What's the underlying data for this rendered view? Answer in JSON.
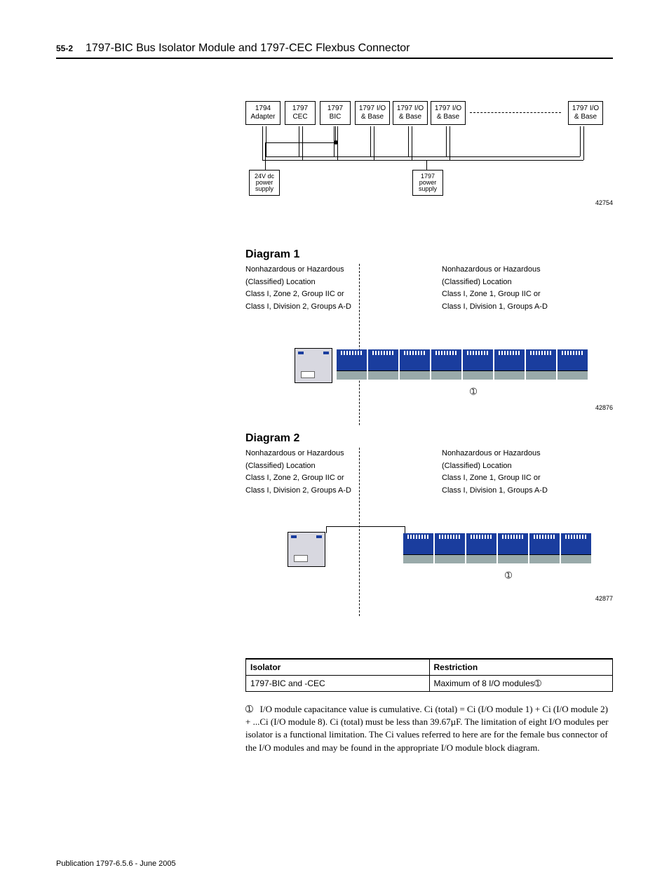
{
  "header": {
    "page_number": "55-2",
    "title": "1797-BIC Bus Isolator Module and 1797-CEC Flexbus Connector"
  },
  "block_diagram": {
    "boxes": [
      {
        "id": "adapter",
        "line1": "1794",
        "line2": "Adapter"
      },
      {
        "id": "cec",
        "line1": "1797",
        "line2": "CEC"
      },
      {
        "id": "bic",
        "line1": "1797",
        "line2": "BIC"
      },
      {
        "id": "io1",
        "line1": "1797 I/O",
        "line2": "& Base"
      },
      {
        "id": "io2",
        "line1": "1797 I/O",
        "line2": "& Base"
      },
      {
        "id": "io3",
        "line1": "1797 I/O",
        "line2": "& Base"
      },
      {
        "id": "ion",
        "line1": "1797 I/O",
        "line2": "& Base"
      }
    ],
    "ps1": {
      "line1": "24V dc",
      "line2": "power",
      "line3": "supply"
    },
    "ps2": {
      "line1": "1797",
      "line2": "power",
      "line3": "supply"
    },
    "fig_id": "42754"
  },
  "diagram1": {
    "title": "Diagram 1",
    "left_loc": {
      "l1": "Nonhazardous or Hazardous",
      "l2": "(Classified) Location",
      "l3": "Class I, Zone 2, Group IIC or",
      "l4": "Class I, Division 2, Groups A-D"
    },
    "right_loc": {
      "l1": "Nonhazardous or Hazardous",
      "l2": "(Classified) Location",
      "l3": "Class I, Zone 1, Group IIC or",
      "l4": "Class I, Division 1, Groups A-D"
    },
    "marker": "➀",
    "fig_id": "42876"
  },
  "diagram2": {
    "title": "Diagram 2",
    "left_loc": {
      "l1": "Nonhazardous or Hazardous",
      "l2": "(Classified) Location",
      "l3": "Class I, Zone 2, Group IIC or",
      "l4": "Class I, Division 2, Groups A-D"
    },
    "right_loc": {
      "l1": "Nonhazardous or Hazardous",
      "l2": "(Classified) Location",
      "l3": "Class I, Zone 1, Group IIC or",
      "l4": "Class I, Division 1, Groups A-D"
    },
    "marker": "➀",
    "fig_id": "42877"
  },
  "table": {
    "headers": {
      "c1": "Isolator",
      "c2": "Restriction"
    },
    "row": {
      "c1": "1797-BIC and -CEC",
      "c2": "Maximum of 8 I/O modules",
      "marker": "➀"
    }
  },
  "footnote": {
    "marker": "➀",
    "text": "I/O module capacitance value is cumulative. Ci (total) = Ci (I/O module 1) + Ci (I/O module 2) + ...Ci (I/O module 8). Ci (total) must be less than 39.67µF. The limitation of eight I/O modules per isolator is a functional limitation. The Ci values referred to here are for the female bus connector of the I/O modules and may be found in the appropriate I/O module block diagram."
  },
  "publication": "Publication 1797-6.5.6 - June 2005"
}
